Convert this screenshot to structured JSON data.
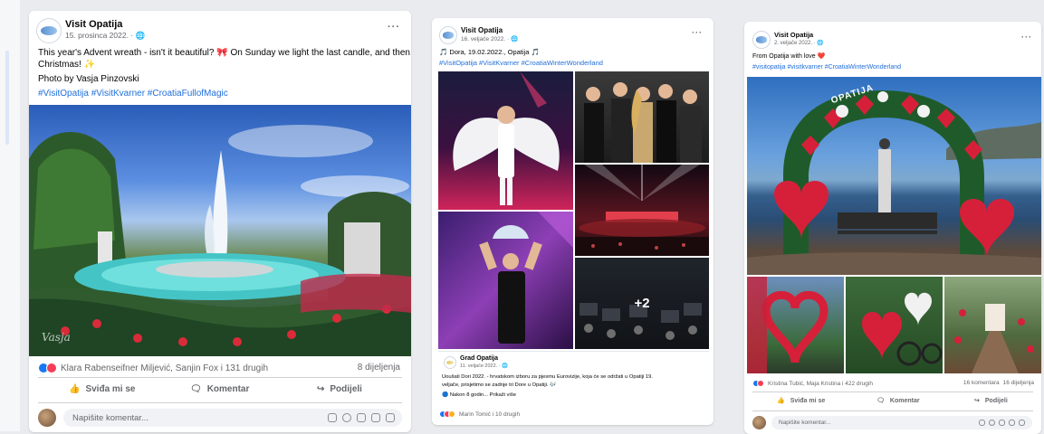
{
  "posts": [
    {
      "page_name": "Visit Opatija",
      "meta": "15. prosinca 2022. · ",
      "text_line1": "This year's Advent wreath - isn't it beautiful? 🎀 On Sunday we light the last candle, and then...",
      "text_line2": "Christmas! ✨",
      "credit": "Photo by Vasja Pinzovski",
      "hashtags": "#VisitOpatija #VisitKvarner #CroatiaFullofMagic",
      "watermark": "Vasja",
      "reactions_text": "Klara Rabenseifner Miljević, Sanjin Fox i 131 drugih",
      "shares_text": "8 dijeljenja",
      "like_label": "Sviđa mi se",
      "comment_label": "Komentar",
      "share_label": "Podijeli",
      "comment_placeholder": "Napišite komentar..."
    },
    {
      "page_name": "Visit Opatija",
      "meta": "16. veljače 2022. · ",
      "text_line1": "🎵 Dora, 19.02.2022., Opatija 🎵",
      "hashtags": "#VisitOpatija #VisitKvarner #CroatiaWinterWonderland",
      "more_count": "+2",
      "shared_page": "Grad Opatija",
      "shared_meta": "11. veljače 2022. · ",
      "shared_line1": "Uoušati Dori 2022. - hrvatskom izboru za pjesmu Eurovizije, koja će se održati u Opatiji 19.",
      "shared_line2": "veljače, prisjetimo se zadnje tri Dore u Opatiji. 🎶",
      "shared_line3": "🔵 Nakon 8 godin... Prikaži više",
      "reactions_text": "Marin Tomić i 10 drugih"
    },
    {
      "page_name": "Visit Opatija",
      "meta": "2. veljače 2022. · ",
      "text_line1": "From Opatija with love ❤️",
      "hashtags": "#visitopatija #visitkvarner #CroatiaWinterWonderland",
      "arch_text": "OPATIJA",
      "reactions_text": "Kristina Tubić, Maja Kristina i 422 drugih",
      "comments_text": "16 komentara",
      "shares_text": "16 dijeljenja",
      "like_label": "Sviđa mi se",
      "comment_label": "Komentar",
      "share_label": "Podijeli",
      "comment_placeholder": "Napišite komentar..."
    }
  ],
  "icons": [
    "globe-icon",
    "more-icon",
    "like-icon",
    "comment-icon",
    "share-icon",
    "emoji-icon",
    "camera-icon",
    "gif-icon",
    "sticker-icon"
  ],
  "colors": {
    "link": "#216fdb",
    "like": "#1877f2",
    "love": "#f33e58",
    "muted": "#65676b",
    "bg": "#e9ebee"
  }
}
